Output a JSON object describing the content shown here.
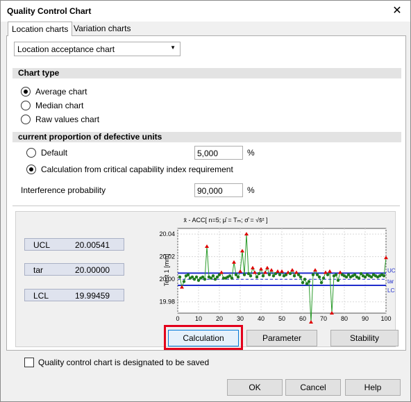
{
  "dialog": {
    "title": "Quality Control Chart",
    "close_symbol": "✕"
  },
  "tabs": [
    {
      "label": "Location charts",
      "active": true
    },
    {
      "label": "Variation charts",
      "active": false
    }
  ],
  "chart_selector": {
    "value": "Location acceptance chart"
  },
  "chart_type": {
    "heading": "Chart type",
    "options": [
      {
        "label": "Average chart",
        "selected": true
      },
      {
        "label": "Median chart",
        "selected": false
      },
      {
        "label": "Raw values chart",
        "selected": false
      }
    ]
  },
  "defective": {
    "heading": "current proportion of defective units",
    "default_label": "Default",
    "default_value": "5,000",
    "calc_label": "Calculation from critical capability index requirement",
    "unit": "%",
    "interference_label": "Interference probability",
    "interference_value": "90,000",
    "interference_unit": "%"
  },
  "limits": [
    {
      "name": "UCL",
      "value": "20.00541"
    },
    {
      "name": "tar",
      "value": "20.00000"
    },
    {
      "name": "LCL",
      "value": "19.99459"
    }
  ],
  "chart_data": {
    "type": "line",
    "title": "x̄ - ACC[ n=5; μ̂ = Tₘ; σ̂ = √s̄² ]",
    "ylabel": "Test 1 [mm]",
    "xlim": [
      0,
      100
    ],
    "ylim": [
      19.97,
      20.045
    ],
    "x_ticks": [
      "0",
      "10",
      "20",
      "30",
      "40",
      "50",
      "60",
      "70",
      "80",
      "90",
      "100"
    ],
    "y_ticks": [
      "20.04",
      "20.02",
      "20.00",
      "19.98"
    ],
    "line_labels": [
      "UCL",
      "tar",
      "LCL"
    ],
    "lines": {
      "UCL": 20.00541,
      "tar": 20.0,
      "LCL": 19.99459
    },
    "series": [
      {
        "values": [
          20.002,
          19.993,
          19.998,
          20.003,
          20.004,
          20.001,
          20.002,
          20.0,
          20.002,
          19.999,
          20.001,
          20.002,
          20.0,
          20.029,
          20.002,
          20.001,
          20.003,
          20.0,
          20.002,
          20.004,
          20.006,
          20.001,
          20.001,
          20.002,
          20.003,
          20.001,
          20.015,
          20.004,
          20.002,
          20.007,
          20.025,
          20.004,
          20.04,
          20.005,
          20.003,
          20.01,
          20.006,
          20.002,
          20.005,
          20.009,
          20.003,
          20.006,
          20.01,
          20.004,
          20.008,
          20.003,
          20.005,
          20.007,
          20.004,
          20.007,
          20.003,
          20.004,
          20.006,
          20.005,
          20.008,
          20.003,
          20.006,
          20.004,
          20.002,
          19.997,
          20.0,
          19.996,
          19.998,
          19.962,
          20.004,
          20.008,
          20.004,
          20.002,
          19.997,
          20.001,
          20.006,
          20.004,
          20.007,
          19.97,
          20.003,
          20.004,
          19.999,
          20.006,
          20.004,
          20.003,
          20.002,
          20.004,
          20.002,
          20.003,
          20.004,
          20.002,
          20.001,
          20.005,
          20.003,
          20.002,
          20.004,
          20.003,
          20.002,
          20.004,
          20.003,
          20.002,
          20.003,
          20.004,
          20.003,
          20.019
        ]
      }
    ]
  },
  "buttons": {
    "calculation": "Calculation",
    "parameter": "Parameter",
    "stability": "Stability"
  },
  "save_checkbox": {
    "label": "Quality control chart is designated to be saved",
    "checked": false
  },
  "footer": {
    "ok": "OK",
    "cancel": "Cancel",
    "help": "Help"
  }
}
